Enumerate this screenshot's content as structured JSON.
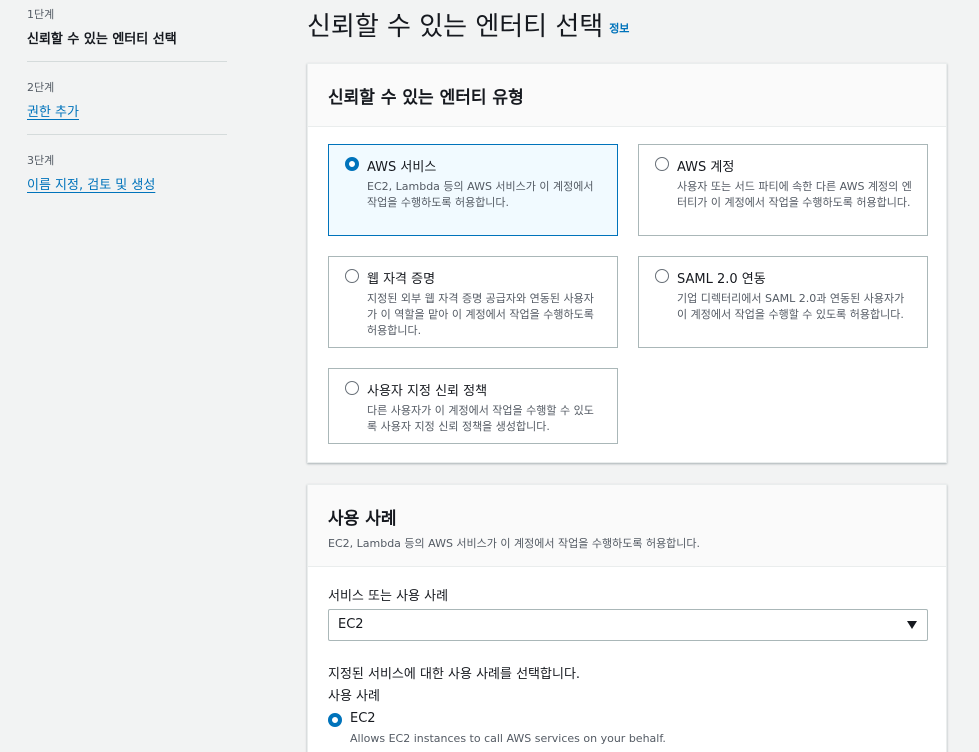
{
  "steps": [
    {
      "number": "1단계",
      "title": "신뢰할 수 있는 엔터티 선택"
    },
    {
      "number": "2단계",
      "title": "권한 추가"
    },
    {
      "number": "3단계",
      "title": "이름 지정, 검토 및 생성"
    }
  ],
  "page": {
    "title": "신뢰할 수 있는 엔터티 선택",
    "info": "정보"
  },
  "entity_panel": {
    "heading": "신뢰할 수 있는 엔터티 유형",
    "options": [
      {
        "title": "AWS 서비스",
        "desc": "EC2, Lambda 등의 AWS 서비스가 이 계정에서 작업을 수행하도록 허용합니다.",
        "selected": true
      },
      {
        "title": "AWS 계정",
        "desc": "사용자 또는 서드 파티에 속한 다른 AWS 계정의 엔터티가 이 계정에서 작업을 수행하도록 허용합니다.",
        "selected": false
      },
      {
        "title": "웹 자격 증명",
        "desc": "지정된 외부 웹 자격 증명 공급자와 연동된 사용자가 이 역할을 맡아 이 계정에서 작업을 수행하도록 허용합니다.",
        "selected": false
      },
      {
        "title": "SAML 2.0 연동",
        "desc": "기업 디렉터리에서 SAML 2.0과 연동된 사용자가 이 계정에서 작업을 수행할 수 있도록 허용합니다.",
        "selected": false
      },
      {
        "title": "사용자 지정 신뢰 정책",
        "desc": "다른 사용자가 이 계정에서 작업을 수행할 수 있도록 사용자 지정 신뢰 정책을 생성합니다.",
        "selected": false
      }
    ]
  },
  "use_case_panel": {
    "heading": "사용 사례",
    "desc": "EC2, Lambda 등의 AWS 서비스가 이 계정에서 작업을 수행하도록 허용합니다.",
    "service_label": "서비스 또는 사용 사례",
    "service_value": "EC2",
    "instruction": "지정된 서비스에 대한 사용 사례를 선택합니다.",
    "use_case_label": "사용 사례",
    "use_case_option": {
      "title": "EC2",
      "desc": "Allows EC2 instances to call AWS services on your behalf.",
      "selected": true
    }
  },
  "colors": {
    "accent": "#0073bb",
    "background": "#f2f3f3"
  }
}
